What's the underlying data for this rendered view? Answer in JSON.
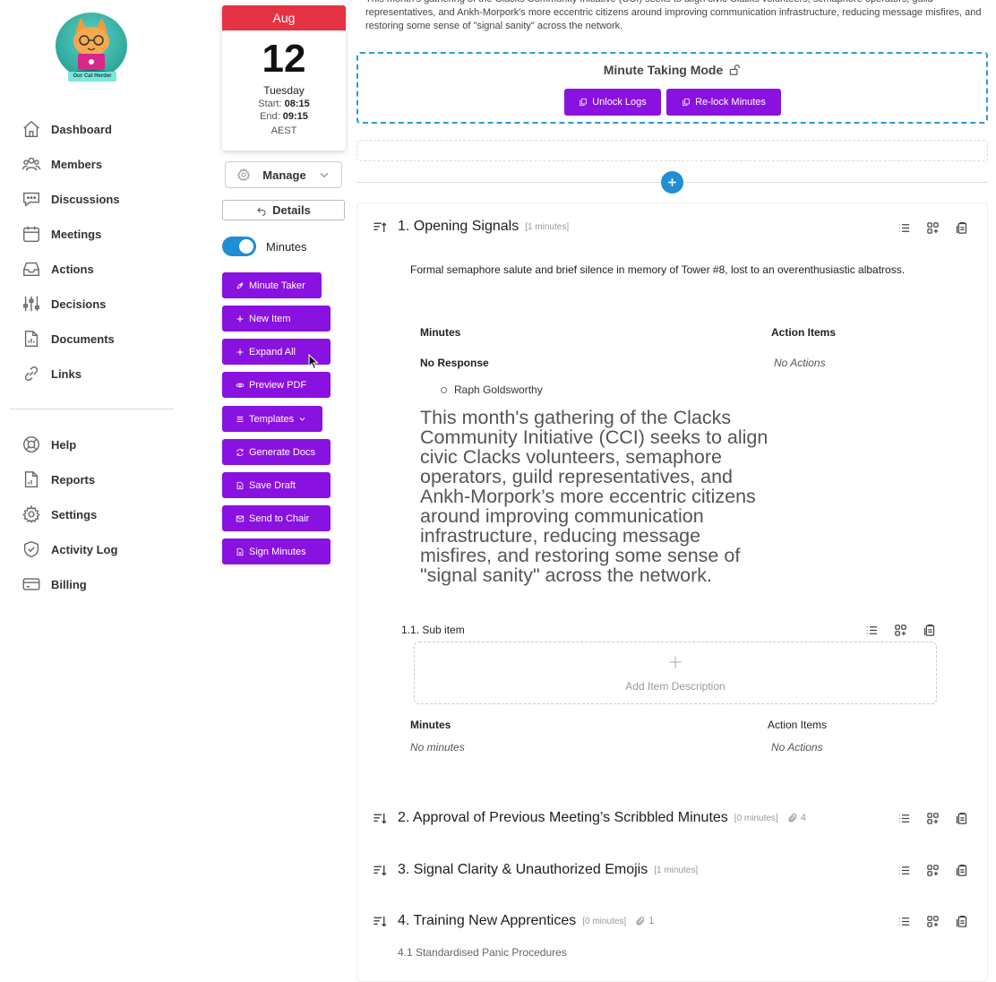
{
  "brand": {
    "logo_text": "Our Cat Herder"
  },
  "nav": {
    "primary": [
      {
        "label": "Dashboard",
        "icon": "home-icon"
      },
      {
        "label": "Members",
        "icon": "users-icon"
      },
      {
        "label": "Discussions",
        "icon": "chat-icon"
      },
      {
        "label": "Meetings",
        "icon": "calendar-icon"
      },
      {
        "label": "Actions",
        "icon": "inbox-icon"
      },
      {
        "label": "Decisions",
        "icon": "sliders-icon"
      },
      {
        "label": "Documents",
        "icon": "document-chart-icon"
      },
      {
        "label": "Links",
        "icon": "link-icon"
      }
    ],
    "secondary": [
      {
        "label": "Help",
        "icon": "lifebuoy-icon"
      },
      {
        "label": "Reports",
        "icon": "report-icon"
      },
      {
        "label": "Settings",
        "icon": "gear-icon"
      },
      {
        "label": "Activity Log",
        "icon": "shield-check-icon"
      },
      {
        "label": "Billing",
        "icon": "credit-card-icon"
      }
    ]
  },
  "calendar": {
    "month": "Aug",
    "day": "12",
    "weekday": "Tuesday",
    "start_label": "Start:",
    "start_time": "08:15",
    "end_label": "End:",
    "end_time": "09:15",
    "timezone": "AEST"
  },
  "manage": {
    "label": "Manage"
  },
  "details": {
    "label": "Details"
  },
  "minutes_toggle": {
    "label": "Minutes",
    "on": true
  },
  "actions": [
    {
      "label": "Minute Taker",
      "icon": "rocket-icon"
    },
    {
      "label": "New Item",
      "icon": "plus-icon"
    },
    {
      "label": "Expand All",
      "icon": "plus-icon"
    },
    {
      "label": "Preview PDF",
      "icon": "eye-icon"
    },
    {
      "label": "Templates",
      "icon": "list-icon"
    },
    {
      "label": "Generate Docs",
      "icon": "refresh-icon"
    },
    {
      "label": "Save Draft",
      "icon": "file-icon"
    },
    {
      "label": "Send to Chair",
      "icon": "mail-icon"
    },
    {
      "label": "Sign Minutes",
      "icon": "file-icon"
    }
  ],
  "intro_text": "This month's gathering of the Clacks Community Initiative (CCI) seeks to align civic Clacks volunteers, semaphore operators, guild representatives, and Ankh-Morpork's more eccentric citizens around improving communication infrastructure, reducing message misfires, and restoring some sense of \"signal sanity\" across the network.",
  "minute_mode": {
    "title": "Minute Taking Mode",
    "unlock_label": "Unlock Logs",
    "relock_label": "Re-lock Minutes"
  },
  "items": [
    {
      "title": "1. Opening Signals",
      "minutes": "[1 minutes]",
      "description": "Formal semaphore salute and brief silence in memory of Tower #8, lost to an overenthusiastic albatross.",
      "minutes_header": "Minutes",
      "action_items_header": "Action Items",
      "minutes_status": "No Response",
      "attendee": "Raph Goldsworthy",
      "actions_status": "No Actions",
      "body_text": "This month's gathering of the Clacks Community Initiative (CCI) seeks to align civic Clacks volunteers, semaphore operators, guild representatives, and Ankh-Morpork’s more eccentric citizens around improving communication infrastructure, reducing message misfires, and restoring some sense of \"signal sanity\" across the network.",
      "sub": {
        "title": "1.1. Sub item",
        "add_label": "Add Item Description",
        "minutes_header": "Minutes",
        "action_items_header": "Action Items",
        "minutes_status": "No minutes",
        "actions_status": "No Actions"
      }
    },
    {
      "title": "2. Approval of Previous Meeting’s Scribbled Minutes",
      "minutes": "[0 minutes]",
      "attachments": "4"
    },
    {
      "title": "3. Signal Clarity & Unauthorized Emojis",
      "minutes": "[1 minutes]"
    },
    {
      "title": "4. Training New Apprentices",
      "minutes": "[0 minutes]",
      "attachments": "1",
      "sub_title": "4.1 Standardised Panic Procedures"
    }
  ]
}
